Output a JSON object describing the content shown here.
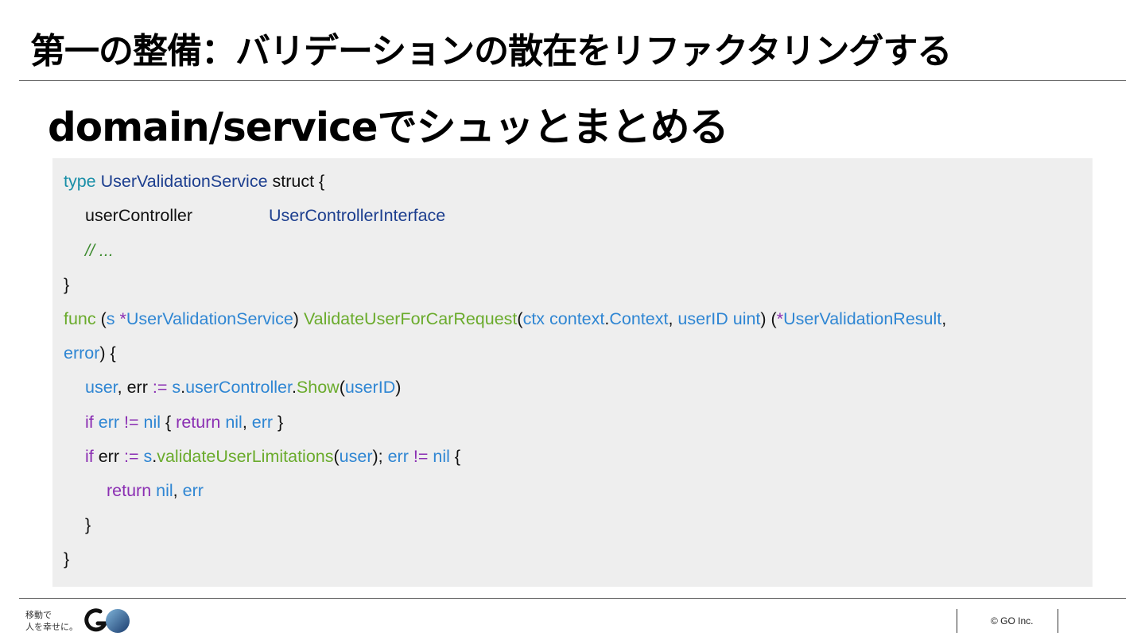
{
  "header": {
    "title": "第一の整備：バリデーションの散在をリファクタリングする",
    "subtitle": "domain/serviceでシュッとまとめる"
  },
  "code": {
    "line1": {
      "kw": "type",
      "name": "UserValidationService",
      "rest": " struct {"
    },
    "line2": {
      "field": "userController",
      "type": "UserControllerInterface"
    },
    "line3": {
      "comment": "// ..."
    },
    "line4": {
      "text": "}"
    },
    "line5": {
      "func": "func",
      "open": " (",
      "recv": "s",
      "star": " *",
      "recvType": "UserValidationService",
      "close": ") ",
      "method": "ValidateUserForCarRequest",
      "p1": "(",
      "ctx": "ctx",
      "sp1": " ",
      "ctxPkg": "context",
      "dot1": ".",
      "ctxType": "Context",
      "comma1": ", ",
      "uid": "userID",
      "sp2": " ",
      "uidType": "uint",
      "p2": ") (",
      "star2": "*",
      "resType": "UserValidationResult",
      "comma2": ","
    },
    "line6": {
      "errType": "error",
      "rest": ") {"
    },
    "line7": {
      "user": "user",
      "comma": ", ",
      "err": "err",
      "assign": " := ",
      "s": "s",
      "dot1": ".",
      "ctrl": "userController",
      "dot2": ".",
      "show": "Show",
      "p1": "(",
      "uid": "userID",
      "p2": ")"
    },
    "line8": {
      "if": "if",
      "sp": " ",
      "err": "err",
      "neq": " != ",
      "nil": "nil",
      "open": " { ",
      "ret": "return",
      "sp2": " ",
      "nil2": "nil",
      "comma": ", ",
      "err2": "err",
      "close": " }"
    },
    "line9": {
      "if": "if",
      "err": " err",
      "assign": " := ",
      "s": "s",
      "dot": ".",
      "fn": "validateUserLimitations",
      "p1": "(",
      "user": "user",
      "p2": "); ",
      "err2": "err",
      "neq": " != ",
      "nil": "nil",
      "open": " {"
    },
    "line10": {
      "ret": "return",
      "sp": " ",
      "nil": "nil",
      "comma": ", ",
      "err": "err"
    },
    "line11": {
      "text": "}"
    },
    "line12": {
      "text": "}"
    }
  },
  "footer": {
    "logo_tagline": "移動で\n人を幸せに。",
    "copyright": "© GO Inc."
  }
}
